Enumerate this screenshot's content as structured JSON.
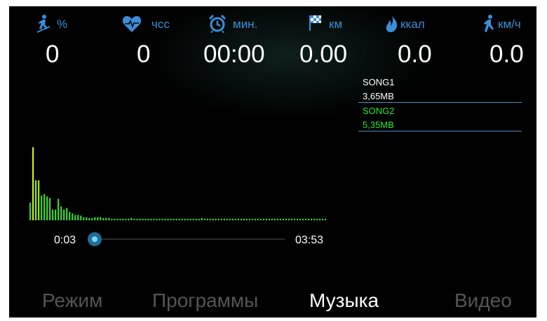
{
  "stats": [
    {
      "icon": "runner-incline-icon",
      "unit": "%",
      "value": "0"
    },
    {
      "icon": "heart-rate-icon",
      "unit": "чсс",
      "value": "0"
    },
    {
      "icon": "alarm-clock-icon",
      "unit": "мин.",
      "value": "00:00"
    },
    {
      "icon": "checkered-flag-icon",
      "unit": "км",
      "value": "0.00"
    },
    {
      "icon": "flame-icon",
      "unit": "ккал",
      "value": "0.0"
    },
    {
      "icon": "runner-speed-icon",
      "unit": "км/ч",
      "value": "0.0"
    }
  ],
  "playlist": [
    {
      "name": "SONG1",
      "size": "3,65MB",
      "active": false
    },
    {
      "name": "SONG2",
      "size": "5,35MB",
      "active": true
    }
  ],
  "player": {
    "current_time": "0:03",
    "total_time": "03:53",
    "progress": 0.013
  },
  "visualizer": {
    "levels": [
      0.23,
      0.95,
      0.52,
      0.52,
      0.32,
      0.34,
      0.31,
      0.29,
      0.14,
      0.14,
      0.28,
      0.18,
      0.14,
      0.16,
      0.11,
      0.09,
      0.07,
      0.07,
      0.06,
      0.04,
      0.04,
      0.03,
      0.03,
      0.04,
      0.04,
      0.04,
      0.03,
      0.03,
      0.03,
      0.02,
      0.02,
      0.02,
      0.02,
      0.02,
      0.02,
      0.02,
      0.03,
      0.02,
      0.02,
      0.02,
      0.02,
      0.02,
      0.02,
      0.02,
      0.02,
      0.02,
      0.02,
      0.02,
      0.02,
      0.02,
      0.02,
      0.02,
      0.02,
      0.02,
      0.02,
      0.02,
      0.02,
      0.02,
      0.02,
      0.02,
      0.02,
      0.03,
      0.02,
      0.02,
      0.02,
      0.02,
      0.02,
      0.02,
      0.02,
      0.02,
      0.02,
      0.02,
      0.02,
      0.02,
      0.02,
      0.02,
      0.02,
      0.02,
      0.02,
      0.02,
      0.02,
      0.02,
      0.02,
      0.02,
      0.02,
      0.02,
      0.02,
      0.02,
      0.02,
      0.02,
      0.02,
      0.02,
      0.02,
      0.02,
      0.02,
      0.02,
      0.02,
      0.02,
      0.02,
      0.02,
      0.02,
      0.02,
      0.02,
      0.02,
      0.02,
      0.02
    ]
  },
  "tabs": [
    {
      "label": "Режим",
      "active": false
    },
    {
      "label": "Программы",
      "active": false
    },
    {
      "label": "Музыка",
      "active": true
    },
    {
      "label": "Видео",
      "active": false
    }
  ],
  "colors": {
    "accent": "#3b8fd8",
    "song_active": "#2ee82e",
    "song_inactive": "#ffffff",
    "viz_bar_bright": "#c8f01e",
    "viz_bar": "#3fd53a",
    "tab_active": "#ffffff",
    "tab_inactive": "#555555"
  }
}
